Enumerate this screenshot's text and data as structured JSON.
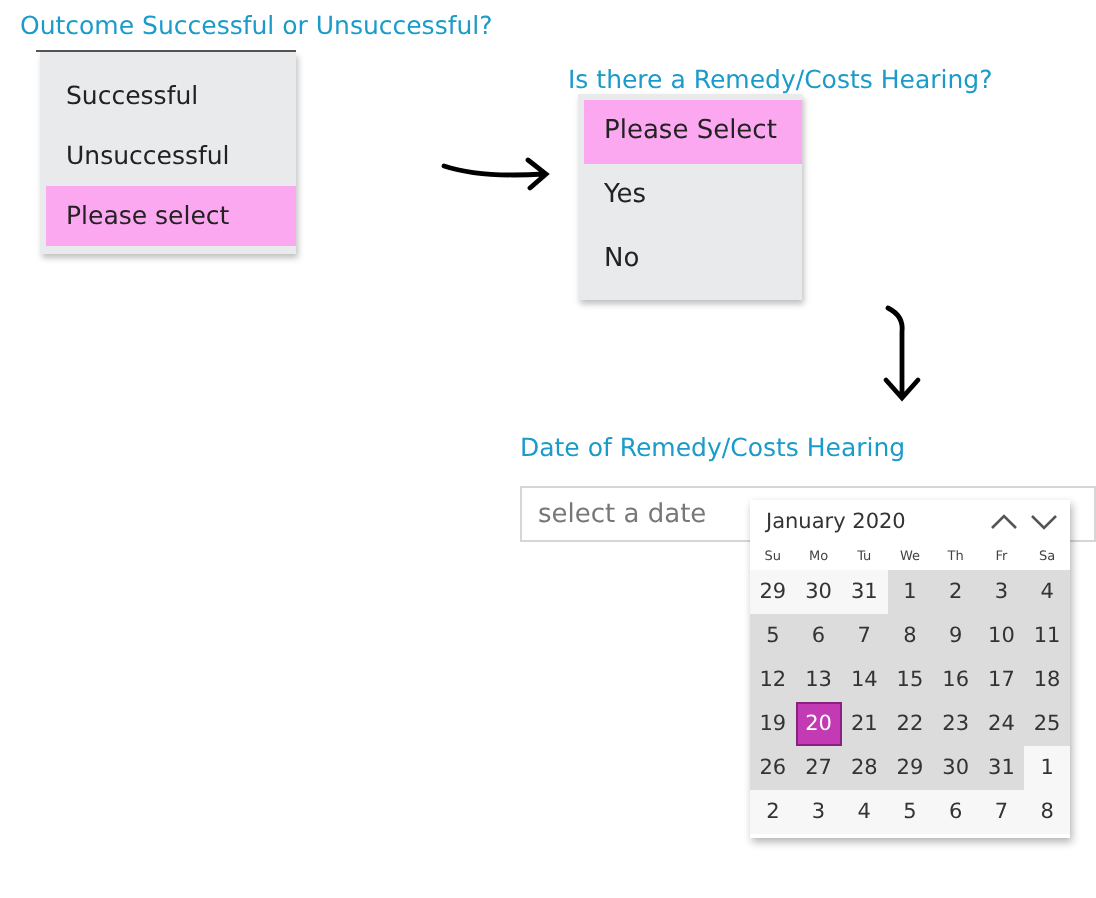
{
  "outcome": {
    "label": "Outcome Successful or Unsuccessful?",
    "options": [
      {
        "label": "Successful",
        "selected": false
      },
      {
        "label": "Unsuccessful",
        "selected": false
      },
      {
        "label": "Please select",
        "selected": true
      }
    ]
  },
  "remedy": {
    "label": "Is there a Remedy/Costs Hearing?",
    "options": [
      {
        "label": "Please Select",
        "selected": true
      },
      {
        "label": "Yes",
        "selected": false
      },
      {
        "label": "No",
        "selected": false
      }
    ]
  },
  "date": {
    "label": "Date of Remedy/Costs Hearing",
    "placeholder": "select a date",
    "calendar": {
      "month": "January 2020",
      "weekdays": [
        "Su",
        "Mo",
        "Tu",
        "We",
        "Th",
        "Fr",
        "Sa"
      ],
      "days": [
        {
          "label": "29",
          "in_month": false,
          "selected": false
        },
        {
          "label": "30",
          "in_month": false,
          "selected": false
        },
        {
          "label": "31",
          "in_month": false,
          "selected": false
        },
        {
          "label": "1",
          "in_month": true,
          "selected": false
        },
        {
          "label": "2",
          "in_month": true,
          "selected": false
        },
        {
          "label": "3",
          "in_month": true,
          "selected": false
        },
        {
          "label": "4",
          "in_month": true,
          "selected": false
        },
        {
          "label": "5",
          "in_month": true,
          "selected": false
        },
        {
          "label": "6",
          "in_month": true,
          "selected": false
        },
        {
          "label": "7",
          "in_month": true,
          "selected": false
        },
        {
          "label": "8",
          "in_month": true,
          "selected": false
        },
        {
          "label": "9",
          "in_month": true,
          "selected": false
        },
        {
          "label": "10",
          "in_month": true,
          "selected": false
        },
        {
          "label": "11",
          "in_month": true,
          "selected": false
        },
        {
          "label": "12",
          "in_month": true,
          "selected": false
        },
        {
          "label": "13",
          "in_month": true,
          "selected": false
        },
        {
          "label": "14",
          "in_month": true,
          "selected": false
        },
        {
          "label": "15",
          "in_month": true,
          "selected": false
        },
        {
          "label": "16",
          "in_month": true,
          "selected": false
        },
        {
          "label": "17",
          "in_month": true,
          "selected": false
        },
        {
          "label": "18",
          "in_month": true,
          "selected": false
        },
        {
          "label": "19",
          "in_month": true,
          "selected": false
        },
        {
          "label": "20",
          "in_month": true,
          "selected": true
        },
        {
          "label": "21",
          "in_month": true,
          "selected": false
        },
        {
          "label": "22",
          "in_month": true,
          "selected": false
        },
        {
          "label": "23",
          "in_month": true,
          "selected": false
        },
        {
          "label": "24",
          "in_month": true,
          "selected": false
        },
        {
          "label": "25",
          "in_month": true,
          "selected": false
        },
        {
          "label": "26",
          "in_month": true,
          "selected": false
        },
        {
          "label": "27",
          "in_month": true,
          "selected": false
        },
        {
          "label": "28",
          "in_month": true,
          "selected": false
        },
        {
          "label": "29",
          "in_month": true,
          "selected": false
        },
        {
          "label": "30",
          "in_month": true,
          "selected": false
        },
        {
          "label": "31",
          "in_month": true,
          "selected": false
        },
        {
          "label": "1",
          "in_month": false,
          "selected": false
        },
        {
          "label": "2",
          "in_month": false,
          "selected": false
        },
        {
          "label": "3",
          "in_month": false,
          "selected": false
        },
        {
          "label": "4",
          "in_month": false,
          "selected": false
        },
        {
          "label": "5",
          "in_month": false,
          "selected": false
        },
        {
          "label": "6",
          "in_month": false,
          "selected": false
        },
        {
          "label": "7",
          "in_month": false,
          "selected": false
        },
        {
          "label": "8",
          "in_month": false,
          "selected": false
        }
      ]
    }
  }
}
